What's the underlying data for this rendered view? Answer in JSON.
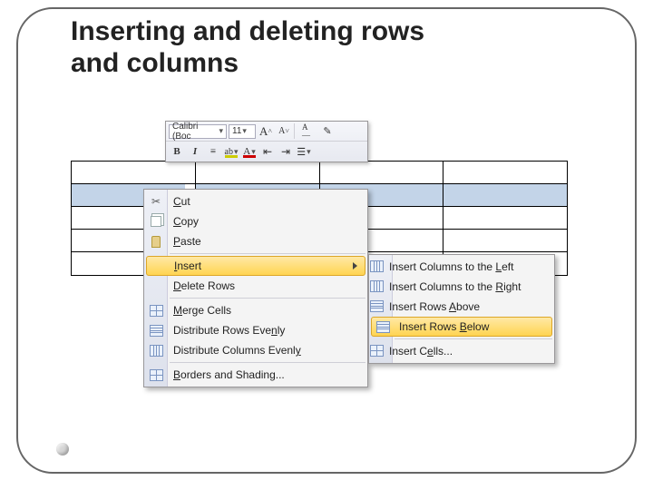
{
  "title_line1": "Inserting and deleting rows",
  "title_line2": "and columns",
  "mini_toolbar": {
    "font_name": "Calibri (Boc",
    "font_size": "11",
    "grow_font": "A",
    "shrink_font": "A"
  },
  "context_menu": {
    "cut": "Cut",
    "copy": "Copy",
    "paste": "Paste",
    "insert": "Insert",
    "delete_rows": "Delete Rows",
    "merge_cells": "Merge Cells",
    "distribute_rows": "Distribute Rows Evenly",
    "distribute_cols": "Distribute Columns Evenly",
    "borders_shading": "Borders and Shading..."
  },
  "submenu": {
    "cols_left": "Insert Columns to the Left",
    "cols_right": "Insert Columns to the Right",
    "rows_above": "Insert Rows Above",
    "rows_below": "Insert Rows Below",
    "cells": "Insert Cells..."
  }
}
